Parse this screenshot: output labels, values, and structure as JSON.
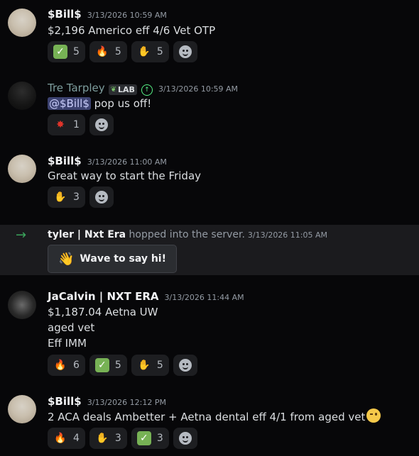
{
  "messages": [
    {
      "author": "$Bill$",
      "time": "3/13/2026 10:59 AM",
      "text": "$2,196 Americo eff 4/6  Vet OTP",
      "reactions": [
        {
          "emoji": "check-mark",
          "count": "5"
        },
        {
          "emoji": "fire",
          "count": "5"
        },
        {
          "emoji": "call-me-hand",
          "count": "5"
        }
      ]
    },
    {
      "author": "Tre Tarpley",
      "badge": "LAB",
      "time": "3/13/2026 10:59 AM",
      "mention": "@$Bill$",
      "text": " pop us off!",
      "reactions": [
        {
          "emoji": "collision",
          "count": "1"
        }
      ]
    },
    {
      "author": "$Bill$",
      "time": "3/13/2026 11:00 AM",
      "text": "Great way to start the Friday",
      "reactions": [
        {
          "emoji": "call-me-hand",
          "count": "3"
        }
      ]
    },
    {
      "author": "JaCalvin | NXT ERA",
      "time": "3/13/2026 11:44 AM",
      "lines": [
        "$1,187.04 Aetna UW",
        "aged vet",
        "Eff IMM"
      ],
      "reactions": [
        {
          "emoji": "fire",
          "count": "6"
        },
        {
          "emoji": "check-mark",
          "count": "5"
        },
        {
          "emoji": "call-me-hand",
          "count": "5"
        }
      ]
    },
    {
      "author": "$Bill$",
      "time": "3/13/2026 12:12 PM",
      "text": "2 ACA deals Ambetter + Aetna dental eff 4/1 from aged vet",
      "reactions": [
        {
          "emoji": "fire",
          "count": "4"
        },
        {
          "emoji": "call-me-hand",
          "count": "3"
        },
        {
          "emoji": "check-mark",
          "count": "3"
        }
      ]
    }
  ],
  "join": {
    "user": "tyler | Nxt Era",
    "text": " hopped into the server.",
    "time": "3/13/2026 11:05 AM",
    "wave_label": "Wave to say hi!"
  },
  "colors": {
    "background": "#070709",
    "join_row": "#1b1b1e",
    "reaction_bg": "#1d1e21",
    "mention_bg": "#3c4270",
    "tre_name": "#7e9e9e",
    "join_arrow": "#3ba55c"
  }
}
